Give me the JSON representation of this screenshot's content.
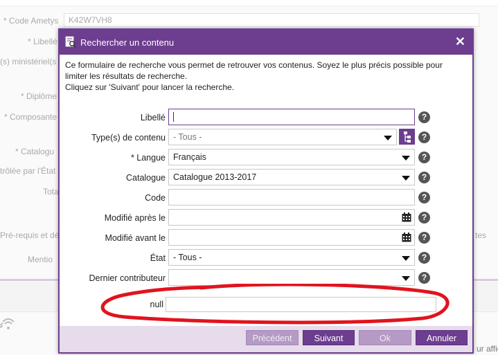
{
  "background": {
    "code_label": "* Code Ametys",
    "code_value": "K42W7VH8",
    "libelle_label": "* Libellé",
    "ministeriel_label": "(s) ministériel(s",
    "diplome_label": "* Diplôme",
    "composante_label": "* Composante",
    "catalogue_label": "* Catalogu",
    "controlee_label": "trôlée par l'État",
    "total_label": "Tota",
    "prerequis_label": "Pré-requis et dé",
    "mention_label": "Mentio",
    "tes_label": "tes",
    "affich_label": "ur affic"
  },
  "dialog": {
    "title": "Rechercher un contenu",
    "close_glyph": "✕",
    "intro_line1": "Ce formulaire de recherche vous permet de retrouver vos contenus. Soyez le plus précis possible pour limiter les résultats de recherche.",
    "intro_line2": "Cliquez sur 'Suivant' pour lancer la recherche.",
    "help_glyph": "?",
    "fields": {
      "libelle": {
        "label": "Libellé",
        "value": ""
      },
      "types": {
        "label": "Type(s) de contenu",
        "value": "- Tous -"
      },
      "langue": {
        "label": "* Langue",
        "value": "Français"
      },
      "catalogue": {
        "label": "Catalogue",
        "value": "Catalogue 2013-2017"
      },
      "code": {
        "label": "Code",
        "value": ""
      },
      "modifie_apres": {
        "label": "Modifié après le",
        "value": ""
      },
      "modifie_avant": {
        "label": "Modifié avant le",
        "value": ""
      },
      "etat": {
        "label": "État",
        "value": "- Tous -"
      },
      "contributeur": {
        "label": "Dernier contributeur",
        "value": ""
      },
      "null_field": {
        "label": "null",
        "value": ""
      }
    },
    "buttons": {
      "precedent": "Précédent",
      "suivant": "Suivant",
      "ok": "Ok",
      "annuler": "Annuler"
    }
  },
  "colors": {
    "accent": "#6d3d8f",
    "annotation": "#e0141e"
  }
}
